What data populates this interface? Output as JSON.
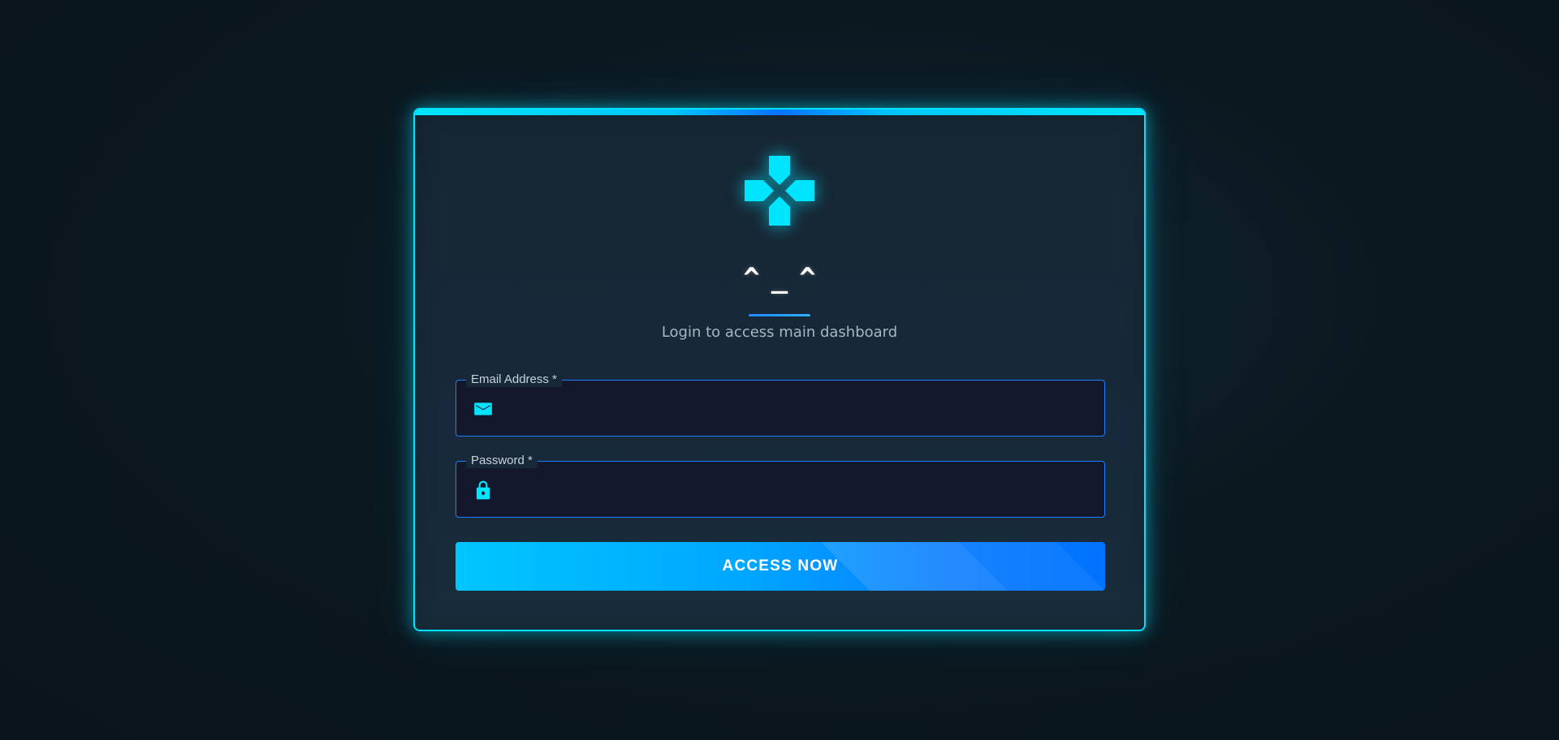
{
  "brand": {
    "logo_icon": "gamepad-dpad-icon",
    "face_text": "^_^",
    "subtitle": "Login to access main dashboard"
  },
  "form": {
    "email": {
      "label": "Email Address *",
      "icon": "envelope-icon",
      "value": "",
      "placeholder": ""
    },
    "password": {
      "label": "Password *",
      "icon": "lock-icon",
      "value": "",
      "placeholder": ""
    },
    "submit_label": "ACCESS NOW"
  },
  "colors": {
    "accent": "#00e5ff",
    "field_border": "#1f7dff",
    "button_start": "#00c6ff",
    "button_end": "#0072ff"
  }
}
